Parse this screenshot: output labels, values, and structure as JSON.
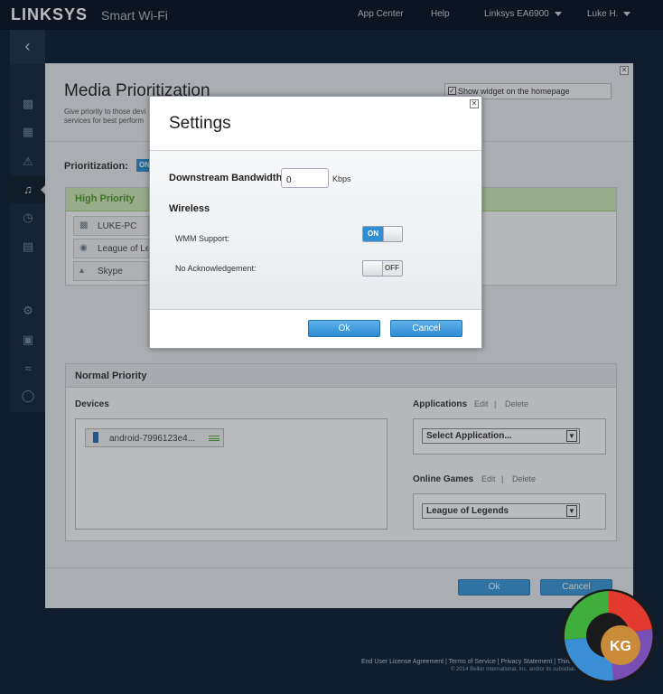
{
  "header": {
    "brand": "LINKSYS",
    "product": "Smart Wi-Fi",
    "nav": {
      "app_center": "App Center",
      "help": "Help",
      "router": "Linksys EA6900",
      "user": "Luke H."
    }
  },
  "sidebar": {
    "back_glyph": "‹",
    "icons": [
      "devices-icon",
      "parental-controls-icon",
      "alert-icon",
      "media-prioritization-icon",
      "speed-test-icon",
      "external-storage-icon",
      "settings-icon",
      "security-icon",
      "wireless-icon",
      "shield-icon"
    ]
  },
  "page": {
    "title": "Media Prioritization",
    "description": "Give priority to those devi services for best perform",
    "widget_checkbox": "Show widget on the homepage",
    "prioritization_label": "Prioritization:",
    "prioritization_state": "ON",
    "high_priority": {
      "title": "High Priority",
      "items": [
        "LUKE-PC",
        "League of Le",
        "Skype"
      ]
    },
    "normal_priority": {
      "title": "Normal Priority",
      "devices_label": "Devices",
      "device_chip": "android-7996123e4...",
      "applications_label": "Applications",
      "applications_select": "Select Application...",
      "online_games_label": "Online Games",
      "online_games_select": "League of Legends",
      "edit": "Edit",
      "delete": "Delete",
      "separator": "|"
    },
    "ok_label": "Ok",
    "cancel_label": "Cancel"
  },
  "modal": {
    "title": "Settings",
    "downstream_label": "Downstream Bandwidth",
    "downstream_value": "0",
    "downstream_unit": "Kbps",
    "wireless_label": "Wireless",
    "wmm_label": "WMM Support:",
    "wmm_state": "ON",
    "noack_label": "No Acknowledgement:",
    "noack_state": "OFF",
    "ok_label": "Ok",
    "cancel_label": "Cancel"
  },
  "footer": {
    "links": "End User License Agreement  |  Terms of Service  |  Privacy Statement  |  Third Party Licenses",
    "copyright": "© 2014 Belkin International, Inc. and/or its subsidiaries and affiliates."
  },
  "watermark": {
    "text": "KG"
  },
  "colors": {
    "accent_blue": "#2e8fd4",
    "high_priority_green": "#4c9a22",
    "header_bg": "#05111f"
  }
}
